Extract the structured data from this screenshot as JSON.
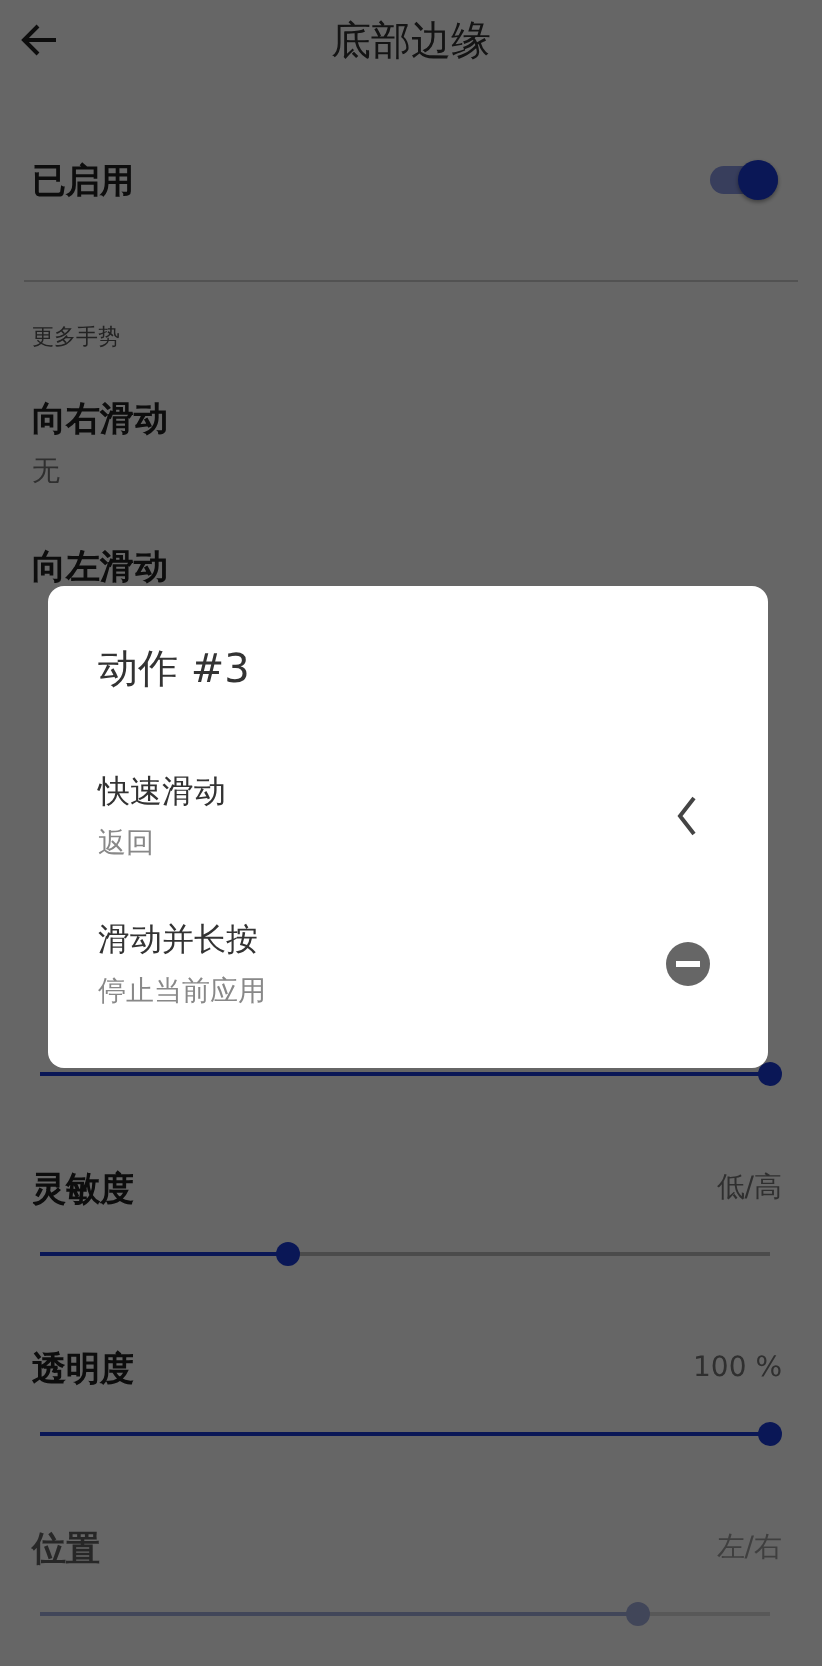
{
  "header": {
    "title": "底部边缘"
  },
  "enabled_toggle": {
    "label": "已启用",
    "on": true
  },
  "section": {
    "title": "更多手势"
  },
  "gestures": [
    {
      "title": "向右滑动",
      "value": "无"
    },
    {
      "title": "向左滑动"
    }
  ],
  "sliders": [
    {
      "level": 1,
      "disabled": false
    },
    {
      "label": "灵敏度",
      "reading": "低/高",
      "level": 0.34,
      "disabled": false
    },
    {
      "label": "透明度",
      "reading": "100 %",
      "level": 1,
      "disabled": false
    },
    {
      "label": "位置",
      "reading": "左/右",
      "level": 0.82,
      "disabled": true
    }
  ],
  "dialog": {
    "title": "动作 #3",
    "actions": [
      {
        "title": "快速滑动",
        "subtitle": "返回",
        "kind": "back"
      },
      {
        "title": "滑动并长按",
        "subtitle": "停止当前应用",
        "kind": "stop"
      }
    ]
  }
}
